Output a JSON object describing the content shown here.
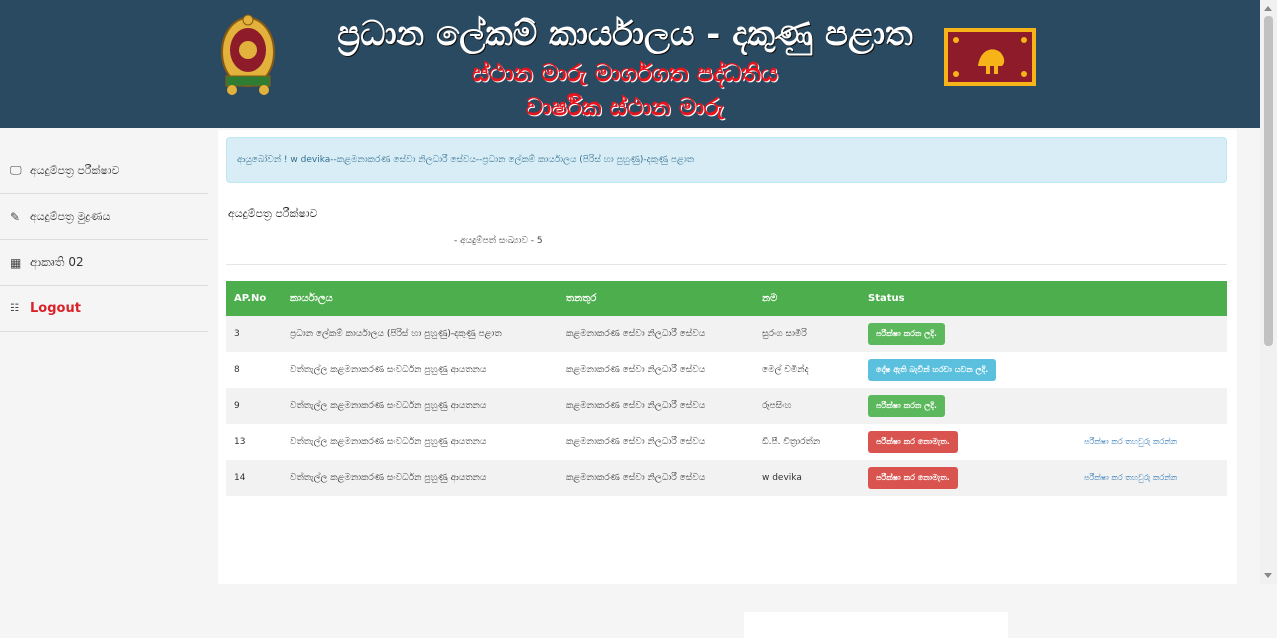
{
  "header": {
    "title": "ප්‍රධාන ලේකම් කාර්යාලය - දකුණු පළාත",
    "subtitle": "ස්ථාන මාරු මාර්ගගත පද්ධතිය",
    "subtitle2": "වාර්ෂික ස්ථාන මාරු"
  },
  "sidebar": {
    "items": [
      {
        "label": "අයදුම්පත්‍ර පරීක්ෂාව",
        "icon": "monitor-icon"
      },
      {
        "label": "අයදුම්පත්‍ර මුද්‍රණය",
        "icon": "edit-icon"
      },
      {
        "label": "ආකෘති 02",
        "icon": "table-icon"
      },
      {
        "label": "Logout",
        "icon": "grid-icon"
      }
    ]
  },
  "alert": {
    "text": "ආයුබෝවන් ! w devika--කළමනාකරණ සේවා නිලධාරී සේවය--ප්‍රධාන ලේකම් කාර්යාලය (පිරිස් හා පුහුණු)-දකුණු පළාත"
  },
  "section": {
    "title": "අයදුම්පත්‍ර පරීක්ෂාව",
    "count_text": "- අයදුම්පත් සංඛ්‍යාව - 5"
  },
  "table": {
    "headers": [
      "AP.No",
      "කාර්යාලය",
      "තනතුර",
      "නම",
      "Status",
      ""
    ],
    "rows": [
      {
        "no": "3",
        "office": "ප්‍රධාන ලේකම් කාර්යාලය (පිරිස් හා පුහුණු)-දකුණු පළාත",
        "post": "කළමනාකරණ සේවා නිලධාරී සේවය",
        "name": "සුරංග සාමිරි",
        "status": "පරීක්ෂා කරන ලදි.",
        "status_color": "green",
        "action": ""
      },
      {
        "no": "8",
        "office": "වත්තැල්ල කළමනාකරණ සංවර්ධන පුහුණු ආයතනය",
        "post": "කළමනාකරණ සේවා නිලධාරී සේවය",
        "name": "මෙල් චමින්ද",
        "status": "දෝෂ ඇති බැවින් හරවා යවන ලදි.",
        "status_color": "blue",
        "action": ""
      },
      {
        "no": "9",
        "office": "වත්තැල්ල කළමනාකරණ සංවර්ධන පුහුණු ආයතනය",
        "post": "කළමනාකරණ සේවා නිලධාරී සේවය",
        "name": "රූපසිංහ",
        "status": "පරීක්ෂා කරන ලදි.",
        "status_color": "green",
        "action": ""
      },
      {
        "no": "13",
        "office": "වත්තැල්ල කළමනාකරණ සංවර්ධන පුහුණු ආයතනය",
        "post": "කළමනාකරණ සේවා නිලධාරී සේවය",
        "name": "ඩී.පී. චිත්‍රාරත්න",
        "status": "පරීක්ෂා කර නොමැත.",
        "status_color": "red",
        "action": "පරීක්ෂා කර තහවුරු කරන්න"
      },
      {
        "no": "14",
        "office": "වත්තැල්ල කළමනාකරණ සංවර්ධන පුහුණු ආයතනය",
        "post": "කළමනාකරණ සේවා නිලධාරී සේවය",
        "name": "w devika",
        "status": "පරීක්ෂා කර නොමැත.",
        "status_color": "red",
        "action": "පරීක්ෂා කර තහවුරු කරන්න"
      }
    ]
  },
  "colors": {
    "header_bg": "#2a4a62",
    "table_header": "#4cae4c",
    "green": "#5cb85c",
    "blue": "#5bc0de",
    "red": "#d9534f"
  }
}
